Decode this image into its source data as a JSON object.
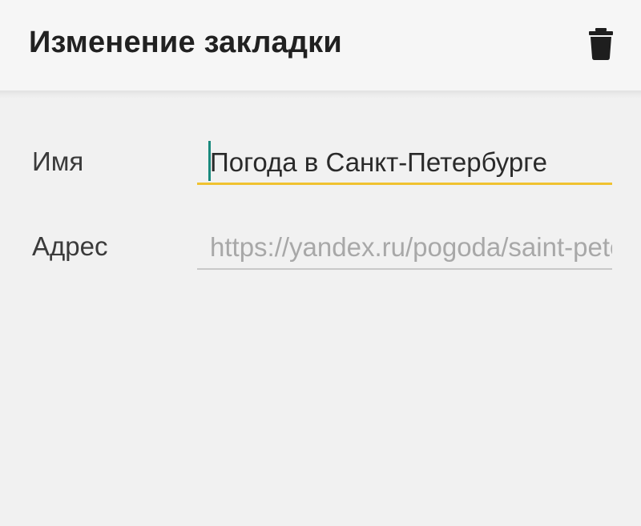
{
  "toolbar": {
    "title": "Изменение закладки",
    "delete_icon": "trash-icon"
  },
  "form": {
    "name": {
      "label": "Имя",
      "value": "Погода в Санкт-Петербурге"
    },
    "address": {
      "label": "Адрес",
      "placeholder": "https://yandex.ru/pogoda/saint-petersburg"
    }
  },
  "colors": {
    "active_underline": "#f0c230",
    "cursor": "#1a8a7e",
    "background": "#f1f1f1"
  }
}
